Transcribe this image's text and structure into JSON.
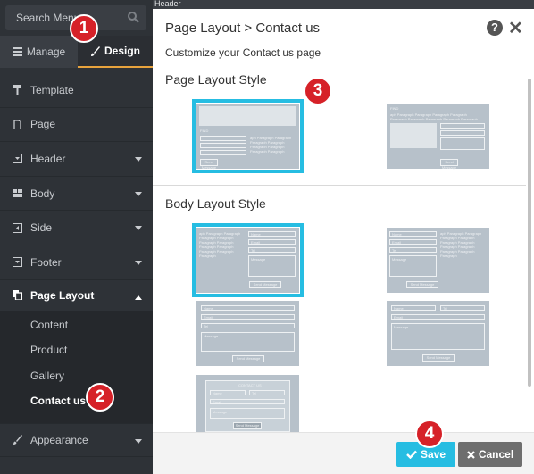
{
  "sidebar": {
    "search_placeholder": "Search Menu",
    "tabs": {
      "manage": "Manage",
      "design": "Design"
    },
    "items": [
      {
        "label": "Template"
      },
      {
        "label": "Page"
      },
      {
        "label": "Header"
      },
      {
        "label": "Body"
      },
      {
        "label": "Side"
      },
      {
        "label": "Footer"
      },
      {
        "label": "Page Layout"
      },
      {
        "label": "Appearance"
      }
    ],
    "sub_items": [
      {
        "label": "Content"
      },
      {
        "label": "Product"
      },
      {
        "label": "Gallery"
      },
      {
        "label": "Contact us"
      }
    ]
  },
  "topbar": {
    "label": "Header"
  },
  "dialog": {
    "title": "Page Layout > Contact us",
    "subtitle": "Customize your Contact us page",
    "help_glyph": "?",
    "close_glyph": "✕",
    "sections": {
      "page_layout": "Page Layout Style",
      "body_layout": "Body Layout Style"
    },
    "footer": {
      "save": "Save",
      "cancel": "Cancel"
    }
  },
  "thumb_text": {
    "title": "FIND",
    "name": "Name",
    "email": "Email",
    "tel": "Tel",
    "message": "Message",
    "send": "Send Message",
    "para": "aph Paragraph Paragraph Paragraph Paragraph Paragraph Paragraph Paragraph Paragraph Paragraph Paragraph Paragraph",
    "contact": "CONTACT US"
  },
  "badges": [
    "1",
    "2",
    "3",
    "4"
  ],
  "colors": {
    "accent": "#26bde2",
    "design_underline": "#e8a33d",
    "badge": "#d62128"
  }
}
